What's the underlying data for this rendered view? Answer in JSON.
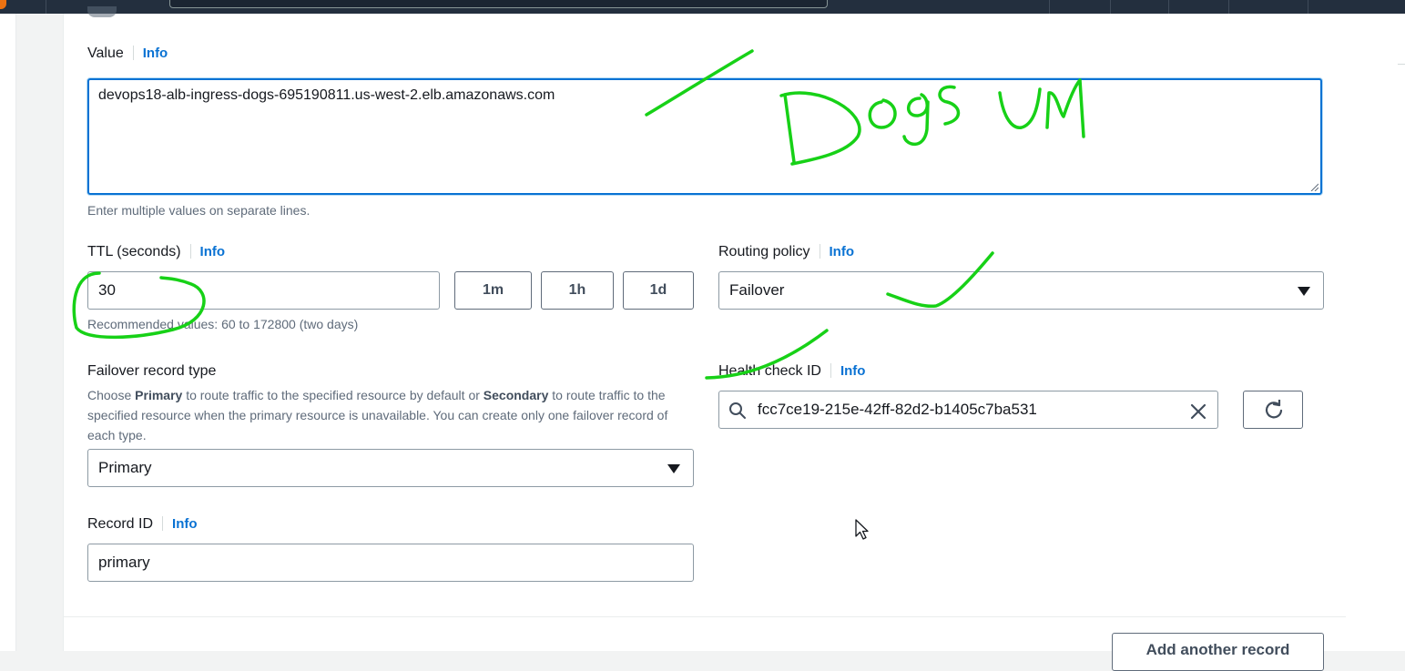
{
  "value_field": {
    "label": "Value",
    "info": "Info",
    "value": "devops18-alb-ingress-dogs-695190811.us-west-2.elb.amazonaws.com",
    "hint": "Enter multiple values on separate lines."
  },
  "ttl": {
    "label": "TTL (seconds)",
    "info": "Info",
    "value": "30",
    "hint": "Recommended values: 60 to 172800 (two days)",
    "quick_buttons": [
      "1m",
      "1h",
      "1d"
    ]
  },
  "routing_policy": {
    "label": "Routing policy",
    "info": "Info",
    "selected": "Failover"
  },
  "failover_record_type": {
    "label": "Failover record type",
    "description_parts": {
      "before": "Choose ",
      "primary": "Primary",
      "middle": " to route traffic to the specified resource by default or ",
      "secondary": "Secondary",
      "after": " to route traffic to the specified resource when the primary resource is unavailable. You can create only one failover record of each type."
    },
    "selected": "Primary"
  },
  "health_check": {
    "label": "Health check ID",
    "info": "Info",
    "value": "fcc7ce19-215e-42ff-82d2-b1405c7ba531"
  },
  "record_id": {
    "label": "Record ID",
    "info": "Info",
    "value": "primary"
  },
  "footer": {
    "add_record_label": "Add another record"
  },
  "annotation": {
    "handwritten_text": "Dogs UM",
    "stroke_color": "#17d117"
  },
  "colors": {
    "link": "#0972d3",
    "focus_border": "#0972d3",
    "topbar": "#232f3e"
  }
}
